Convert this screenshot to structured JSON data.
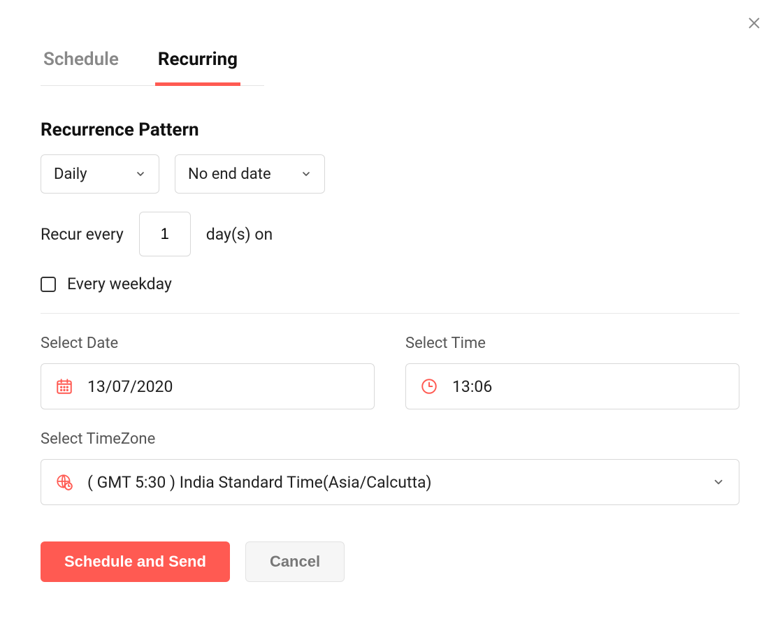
{
  "tabs": {
    "schedule": "Schedule",
    "recurring": "Recurring"
  },
  "section": {
    "title": "Recurrence Pattern"
  },
  "frequency": {
    "selected": "Daily"
  },
  "enddate": {
    "selected": "No end date"
  },
  "recur": {
    "prefix": "Recur every",
    "value": "1",
    "suffix": "day(s) on"
  },
  "weekday": {
    "label": "Every weekday",
    "checked": false
  },
  "date": {
    "label": "Select Date",
    "value": "13/07/2020"
  },
  "time": {
    "label": "Select Time",
    "value": "13:06"
  },
  "timezone": {
    "label": "Select TimeZone",
    "value": "( GMT 5:30 ) India Standard Time(Asia/Calcutta)"
  },
  "actions": {
    "primary": "Schedule and Send",
    "secondary": "Cancel"
  }
}
